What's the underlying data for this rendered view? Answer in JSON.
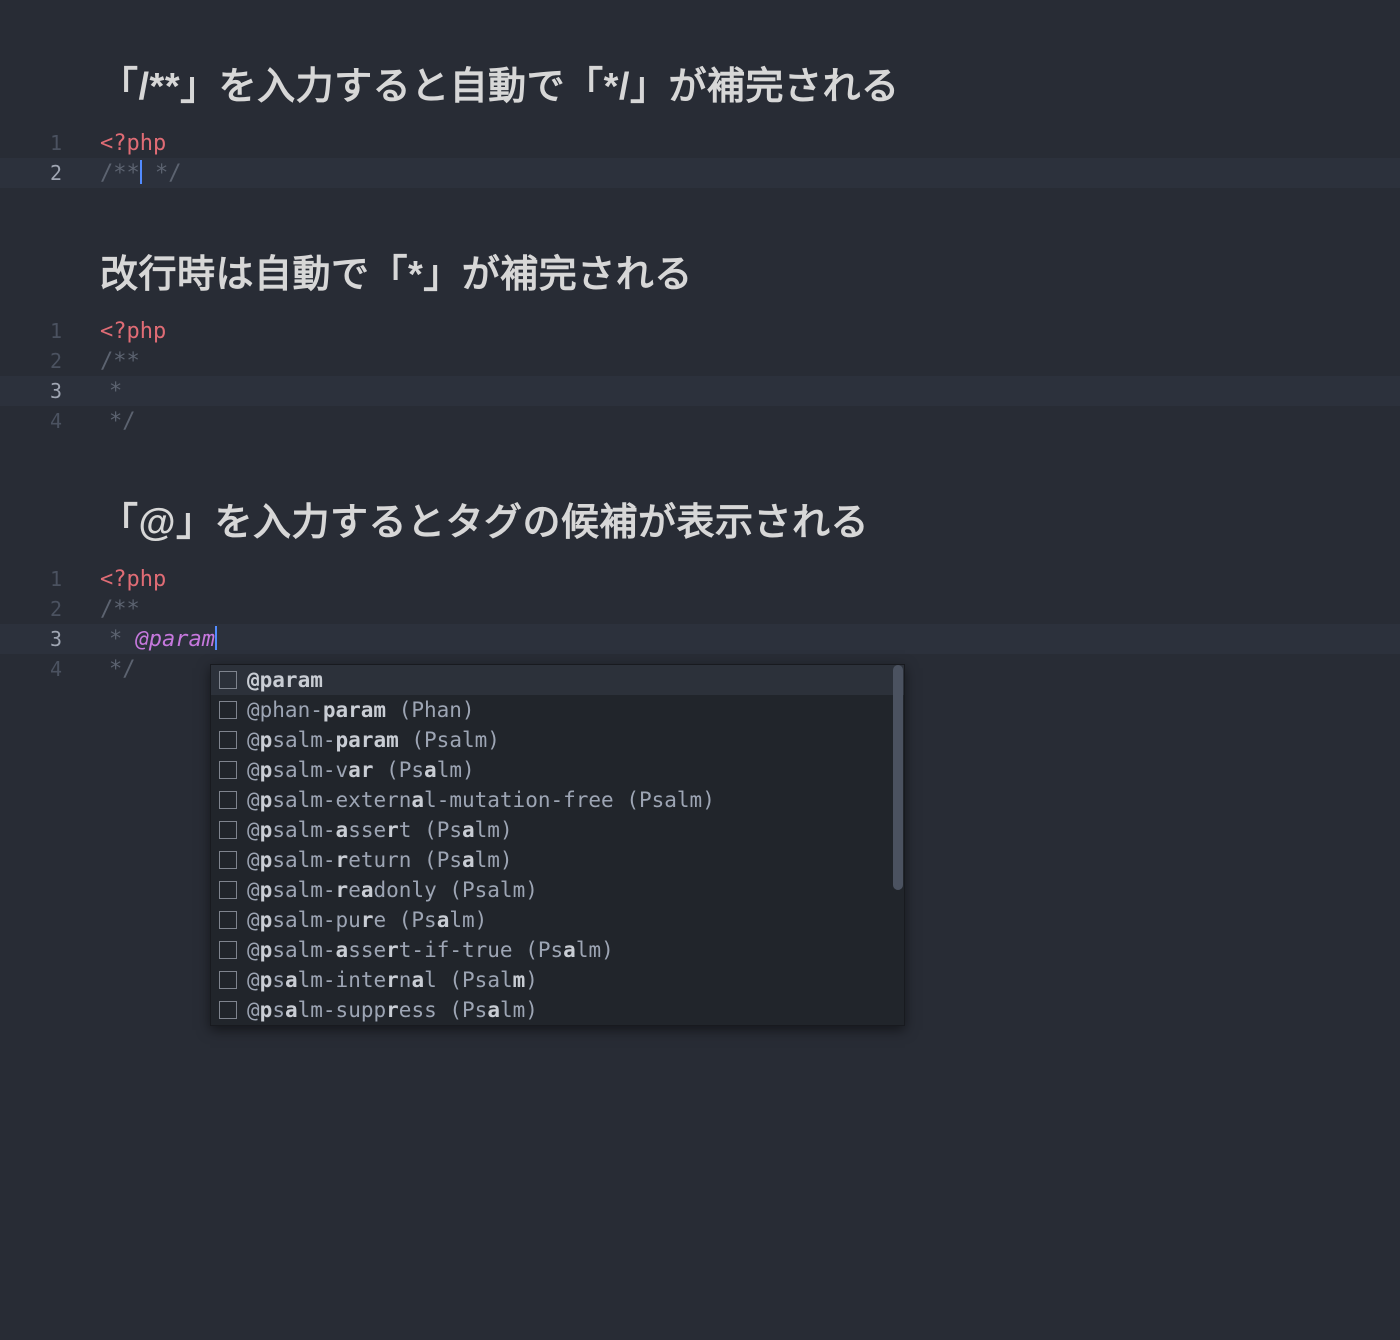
{
  "sections": [
    {
      "heading": "「/**」を入力すると自動で「*/」が補完される",
      "lines": [
        {
          "num": "1",
          "active": false,
          "tokens": [
            {
              "cls": "tok-php",
              "t": "<?php"
            }
          ]
        },
        {
          "num": "2",
          "active": true,
          "tokens": [
            {
              "cls": "tok-comment",
              "t": "/**"
            },
            {
              "cursor": true
            },
            {
              "cls": "tok-comment",
              "t": " */"
            }
          ]
        }
      ]
    },
    {
      "heading": "改行時は自動で「*」が補完される",
      "lines": [
        {
          "num": "1",
          "active": false,
          "tokens": [
            {
              "cls": "tok-php",
              "t": "<?php"
            }
          ]
        },
        {
          "num": "2",
          "active": false,
          "tokens": [
            {
              "cls": "tok-comment",
              "t": "/**"
            }
          ]
        },
        {
          "num": "3",
          "active": true,
          "tokens": [
            {
              "guide": true
            },
            {
              "cls": "tok-comment",
              "t": "* "
            }
          ]
        },
        {
          "num": "4",
          "active": false,
          "tokens": [
            {
              "guide": true
            },
            {
              "cls": "tok-comment",
              "t": "*/"
            }
          ]
        }
      ]
    },
    {
      "heading": "「@」を入力するとタグの候補が表示される",
      "lines": [
        {
          "num": "1",
          "active": false,
          "tokens": [
            {
              "cls": "tok-php",
              "t": "<?php"
            }
          ]
        },
        {
          "num": "2",
          "active": false,
          "tokens": [
            {
              "cls": "tok-comment",
              "t": "/**"
            }
          ]
        },
        {
          "num": "3",
          "active": true,
          "tokens": [
            {
              "guide": true
            },
            {
              "cls": "tok-comment",
              "t": "* "
            },
            {
              "cls": "tok-doctag",
              "t": "@param"
            },
            {
              "cursor": true
            }
          ]
        },
        {
          "num": "4",
          "active": false,
          "tokens": [
            {
              "guide": true
            },
            {
              "cls": "tok-comment",
              "t": "*/"
            }
          ]
        }
      ],
      "autocomplete": {
        "items": [
          {
            "selected": true,
            "parts": [
              {
                "b": true,
                "t": "@param"
              }
            ]
          },
          {
            "selected": false,
            "parts": [
              {
                "b": false,
                "t": "@phan-"
              },
              {
                "b": true,
                "t": "param"
              },
              {
                "b": false,
                "t": " (Phan)"
              }
            ]
          },
          {
            "selected": false,
            "parts": [
              {
                "b": false,
                "t": "@"
              },
              {
                "b": true,
                "t": "p"
              },
              {
                "b": false,
                "t": "salm-"
              },
              {
                "b": true,
                "t": "param"
              },
              {
                "b": false,
                "t": " (Psalm)"
              }
            ]
          },
          {
            "selected": false,
            "parts": [
              {
                "b": false,
                "t": "@"
              },
              {
                "b": true,
                "t": "p"
              },
              {
                "b": false,
                "t": "salm-v"
              },
              {
                "b": true,
                "t": "ar"
              },
              {
                "b": false,
                "t": " (Ps"
              },
              {
                "b": true,
                "t": "a"
              },
              {
                "b": false,
                "t": "lm)"
              }
            ]
          },
          {
            "selected": false,
            "parts": [
              {
                "b": false,
                "t": "@"
              },
              {
                "b": true,
                "t": "p"
              },
              {
                "b": false,
                "t": "salm-extern"
              },
              {
                "b": true,
                "t": "a"
              },
              {
                "b": false,
                "t": "l-mutation-free (Psalm)"
              }
            ]
          },
          {
            "selected": false,
            "parts": [
              {
                "b": false,
                "t": "@"
              },
              {
                "b": true,
                "t": "p"
              },
              {
                "b": false,
                "t": "salm-"
              },
              {
                "b": true,
                "t": "a"
              },
              {
                "b": false,
                "t": "sse"
              },
              {
                "b": true,
                "t": "r"
              },
              {
                "b": false,
                "t": "t (Ps"
              },
              {
                "b": true,
                "t": "a"
              },
              {
                "b": false,
                "t": "lm)"
              }
            ]
          },
          {
            "selected": false,
            "parts": [
              {
                "b": false,
                "t": "@"
              },
              {
                "b": true,
                "t": "p"
              },
              {
                "b": false,
                "t": "salm-"
              },
              {
                "b": true,
                "t": "r"
              },
              {
                "b": false,
                "t": "eturn (Ps"
              },
              {
                "b": true,
                "t": "a"
              },
              {
                "b": false,
                "t": "lm)"
              }
            ]
          },
          {
            "selected": false,
            "parts": [
              {
                "b": false,
                "t": "@"
              },
              {
                "b": true,
                "t": "p"
              },
              {
                "b": false,
                "t": "salm-"
              },
              {
                "b": true,
                "t": "r"
              },
              {
                "b": false,
                "t": "e"
              },
              {
                "b": true,
                "t": "a"
              },
              {
                "b": false,
                "t": "donly (Psalm)"
              }
            ]
          },
          {
            "selected": false,
            "parts": [
              {
                "b": false,
                "t": "@"
              },
              {
                "b": true,
                "t": "p"
              },
              {
                "b": false,
                "t": "salm-pu"
              },
              {
                "b": true,
                "t": "r"
              },
              {
                "b": false,
                "t": "e (Ps"
              },
              {
                "b": true,
                "t": "a"
              },
              {
                "b": false,
                "t": "lm)"
              }
            ]
          },
          {
            "selected": false,
            "parts": [
              {
                "b": false,
                "t": "@"
              },
              {
                "b": true,
                "t": "p"
              },
              {
                "b": false,
                "t": "salm-"
              },
              {
                "b": true,
                "t": "a"
              },
              {
                "b": false,
                "t": "sse"
              },
              {
                "b": true,
                "t": "r"
              },
              {
                "b": false,
                "t": "t-if-true (Ps"
              },
              {
                "b": true,
                "t": "a"
              },
              {
                "b": false,
                "t": "lm)"
              }
            ]
          },
          {
            "selected": false,
            "parts": [
              {
                "b": false,
                "t": "@"
              },
              {
                "b": true,
                "t": "p"
              },
              {
                "b": false,
                "t": "s"
              },
              {
                "b": true,
                "t": "a"
              },
              {
                "b": false,
                "t": "lm-inte"
              },
              {
                "b": true,
                "t": "r"
              },
              {
                "b": false,
                "t": "n"
              },
              {
                "b": true,
                "t": "a"
              },
              {
                "b": false,
                "t": "l (Psal"
              },
              {
                "b": true,
                "t": "m"
              },
              {
                "b": false,
                "t": ")"
              }
            ]
          },
          {
            "selected": false,
            "parts": [
              {
                "b": false,
                "t": "@"
              },
              {
                "b": true,
                "t": "p"
              },
              {
                "b": false,
                "t": "s"
              },
              {
                "b": true,
                "t": "a"
              },
              {
                "b": false,
                "t": "lm-supp"
              },
              {
                "b": true,
                "t": "r"
              },
              {
                "b": false,
                "t": "ess (Ps"
              },
              {
                "b": true,
                "t": "a"
              },
              {
                "b": false,
                "t": "lm)"
              }
            ]
          }
        ]
      }
    }
  ]
}
